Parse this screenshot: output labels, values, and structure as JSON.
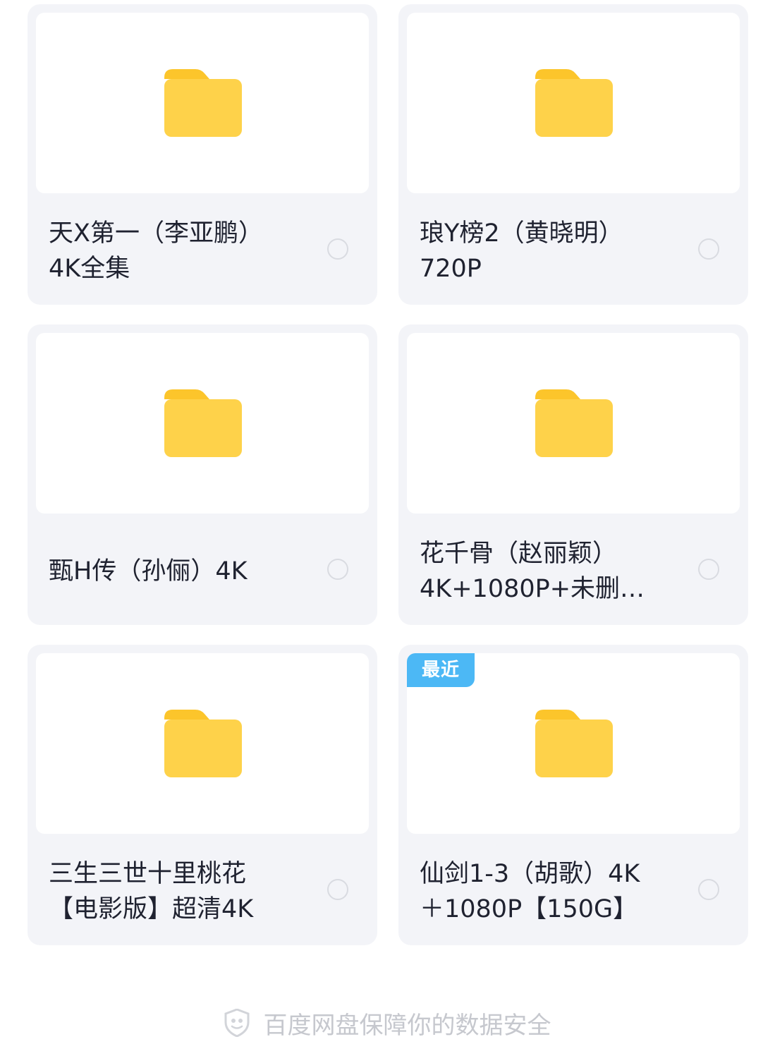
{
  "files": [
    {
      "line1": "天X第一（李亚鹏）",
      "line2": "4K全集",
      "badge": ""
    },
    {
      "line1": "琅Y榜2（黄晓明）",
      "line2": "720P",
      "badge": ""
    },
    {
      "line1": "甄H传（孙俪）4K",
      "line2": "",
      "badge": ""
    },
    {
      "line1": "花千骨（赵丽颖）",
      "line2": "4K+1080P+未删…",
      "badge": ""
    },
    {
      "line1": "三生三世十里桃花",
      "line2": "【电影版】超清4K",
      "badge": ""
    },
    {
      "line1": "仙剑1-3（胡歌）4K",
      "line2": "＋1080P【150G】",
      "badge": "最近"
    }
  ],
  "footer": {
    "text": "百度网盘保障你的数据安全",
    "icon": "shield-icon"
  },
  "colors": {
    "folder": "#fed24a",
    "folder_tab": "#fcc52b",
    "badge": "#4cb8f5",
    "card_bg": "#f3f4f8"
  }
}
